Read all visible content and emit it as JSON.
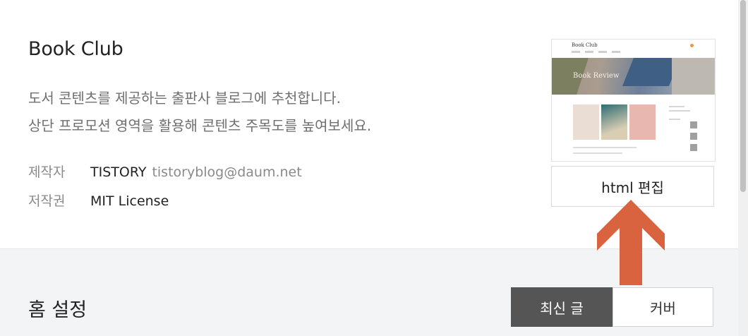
{
  "theme": {
    "name": "Book Club",
    "description": [
      "도서 콘텐츠를 제공하는 출판사 블로그에 추천합니다.",
      "상단 프로모션 영역을 활용해 콘텐츠 주목도를 높여보세요."
    ],
    "author_label": "제작자",
    "author_name": "TISTORY",
    "author_email": "tistoryblog@daum.net",
    "license_label": "저작권",
    "license_value": "MIT License",
    "edit_button_label": "html 편집",
    "thumbnail": {
      "logo": "Book Club",
      "hero_title": "Book Review"
    }
  },
  "home_settings": {
    "title": "홈 설정",
    "options": [
      "최신 글",
      "커버"
    ],
    "selected": "최신 글"
  },
  "colors": {
    "annotation_arrow": "#d9623f",
    "segment_active_bg": "#555555"
  },
  "icons": {
    "annotation": "arrow-up-icon"
  }
}
